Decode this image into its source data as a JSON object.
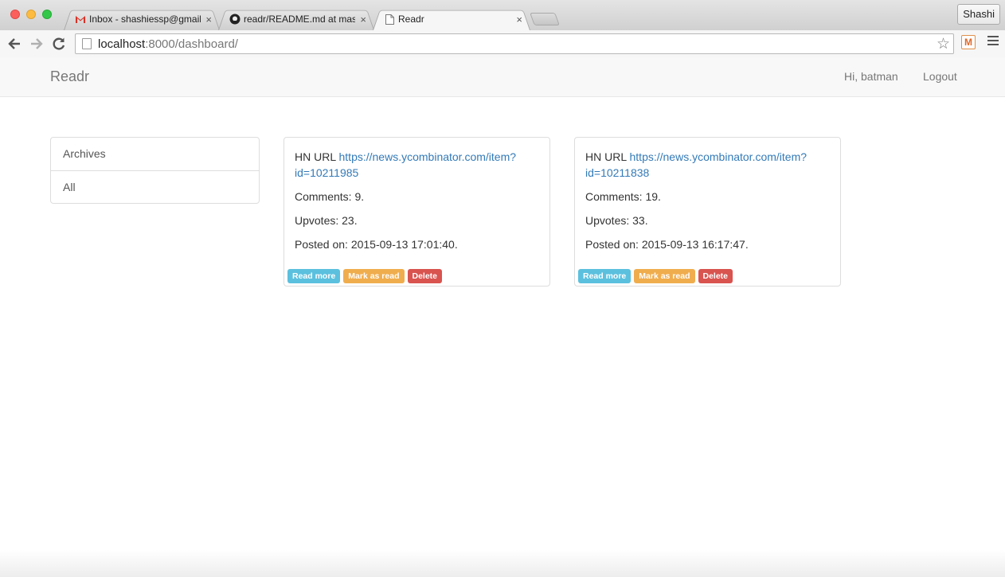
{
  "browser": {
    "tabs": [
      {
        "title": "Inbox - shashiessp@gmail.com",
        "icon": "gmail-icon",
        "close": "×"
      },
      {
        "title": "readr/README.md at master",
        "icon": "github-icon",
        "close": "×"
      },
      {
        "title": "Readr",
        "icon": "page-icon",
        "close": "×"
      }
    ],
    "profile_name": "Shashi",
    "url_host": "localhost",
    "url_rest": ":8000/dashboard/",
    "extension_label": "M",
    "colors": {
      "close": "#fc605c",
      "minimize": "#fdbc40",
      "zoom": "#34c84a"
    }
  },
  "navbar": {
    "brand": "Readr",
    "greeting": "Hi, batman",
    "logout": "Logout"
  },
  "sidebar": {
    "items": [
      {
        "label": "Archives"
      },
      {
        "label": "All"
      }
    ]
  },
  "cards": [
    {
      "hn_label": "HN URL",
      "url": "https://news.ycombinator.com/item?id=10211985",
      "comments": "Comments: 9.",
      "upvotes": "Upvotes: 23.",
      "posted": "Posted on: 2015-09-13 17:01:40.",
      "actions": {
        "read_more": "Read more",
        "mark_read": "Mark as read",
        "delete": "Delete"
      }
    },
    {
      "hn_label": "HN URL",
      "url": "https://news.ycombinator.com/item?id=10211838",
      "comments": "Comments: 19.",
      "upvotes": "Upvotes: 33.",
      "posted": "Posted on: 2015-09-13 16:17:47.",
      "actions": {
        "read_more": "Read more",
        "mark_read": "Mark as read",
        "delete": "Delete"
      }
    }
  ],
  "colors": {
    "link": "#337ab7",
    "info": "#5bc0de",
    "warning": "#f0ad4e",
    "danger": "#d9534f"
  }
}
